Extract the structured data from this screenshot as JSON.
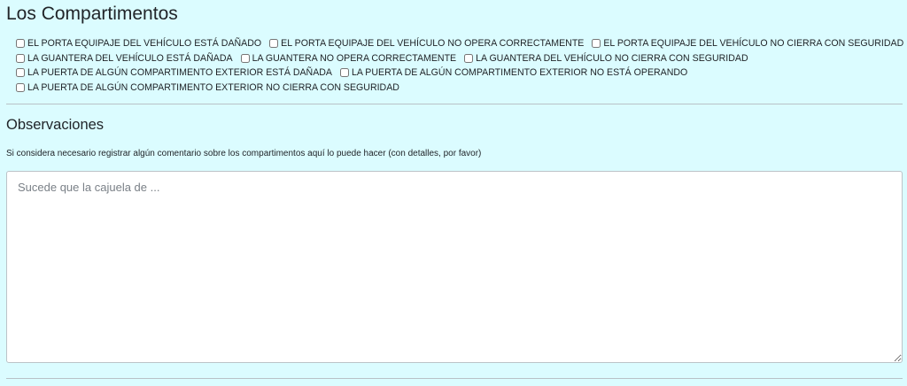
{
  "section": {
    "title": "Los Compartimentos"
  },
  "checkbox_rows": [
    [
      {
        "label": "EL PORTA EQUIPAJE DEL VEHÍCULO ESTÁ DAÑADO",
        "checked": false
      },
      {
        "label": "EL PORTA EQUIPAJE DEL VEHÍCULO NO OPERA CORRECTAMENTE",
        "checked": false
      },
      {
        "label": "EL PORTA EQUIPAJE DEL VEHÍCULO NO CIERRA CON SEGURIDAD",
        "checked": false
      }
    ],
    [
      {
        "label": "LA GUANTERA DEL VEHÍCULO ESTÁ DAÑADA",
        "checked": false
      },
      {
        "label": "LA GUANTERA NO OPERA CORRECTAMENTE",
        "checked": false
      },
      {
        "label": "LA GUANTERA DEL VEHÍCULO NO CIERRA CON SEGURIDAD",
        "checked": false
      }
    ],
    [
      {
        "label": "LA PUERTA DE ALGÚN COMPARTIMENTO EXTERIOR ESTÁ DAÑADA",
        "checked": false
      },
      {
        "label": "LA PUERTA DE ALGÚN COMPARTIMENTO EXTERIOR NO ESTÁ OPERANDO",
        "checked": false
      }
    ],
    [
      {
        "label": "LA PUERTA DE ALGÚN COMPARTIMENTO EXTERIOR NO CIERRA CON SEGURIDAD",
        "checked": false
      }
    ]
  ],
  "observaciones": {
    "title": "Observaciones",
    "hint": "Si considera necesario registrar algún comentario sobre los compartimentos aquí lo puede hacer (con detalles, por favor)",
    "placeholder": "Sucede que la cajuela de ...",
    "value": ""
  },
  "colors": {
    "background": "#dbfcff",
    "divider": "#b8c2c7",
    "text": "#212529"
  }
}
